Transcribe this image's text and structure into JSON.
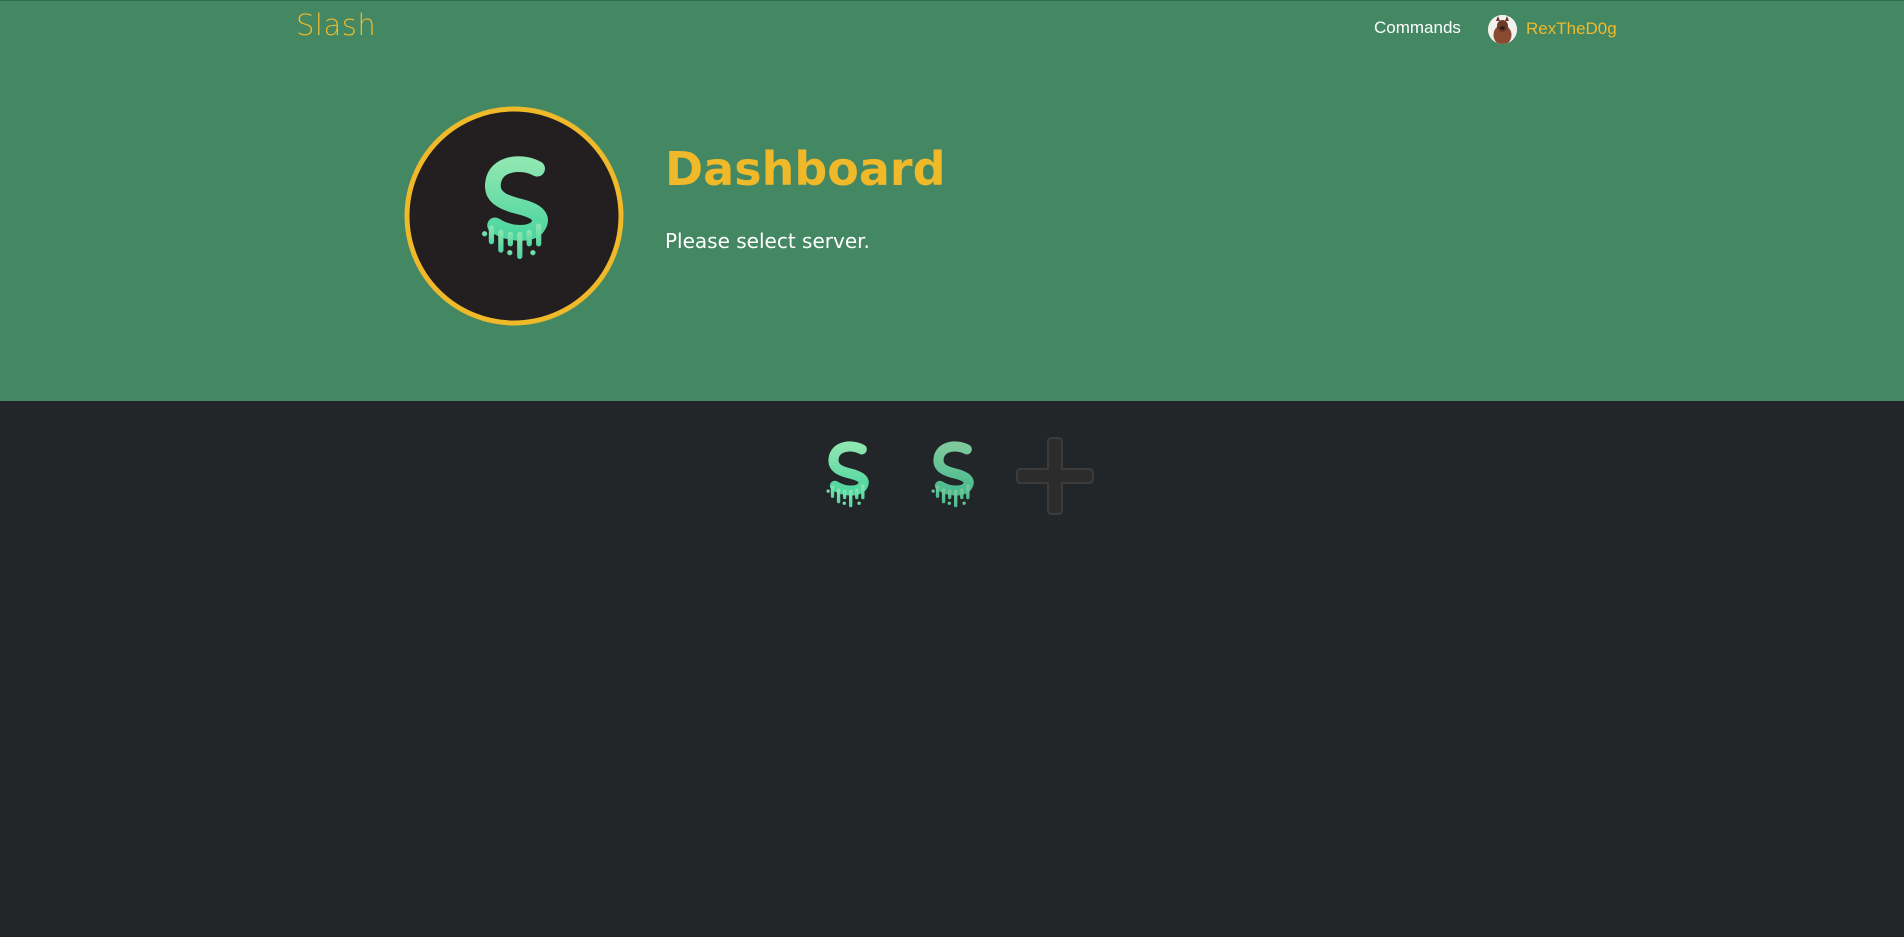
{
  "nav": {
    "brand": "Slash",
    "commands_label": "Commands",
    "user": {
      "name": "RexTheD0g"
    }
  },
  "hero": {
    "title": "Dashboard",
    "subtitle": "Please select server."
  },
  "servers": [
    {
      "icon": "slash-logo-icon",
      "kind": "server"
    },
    {
      "icon": "slash-logo-icon",
      "kind": "server"
    },
    {
      "icon": "plus-icon",
      "kind": "add-server"
    }
  ],
  "colors": {
    "hero_bg": "#448763",
    "page_bg": "#222629",
    "accent": "#f0b929",
    "logo_green": "#5fe3a1"
  }
}
